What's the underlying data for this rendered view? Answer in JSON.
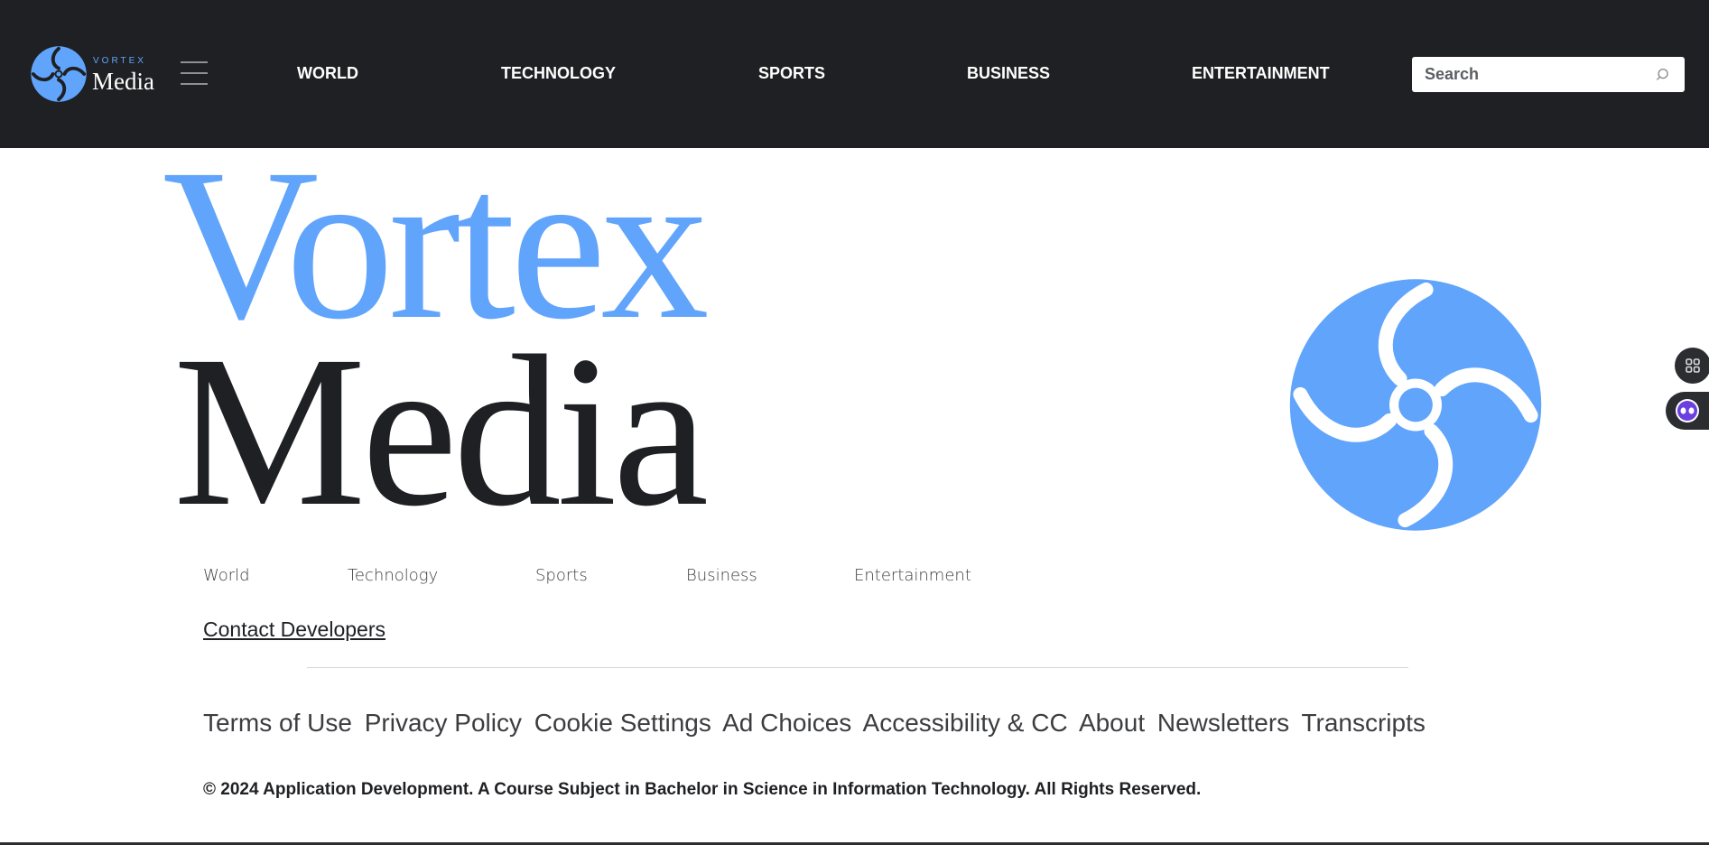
{
  "header": {
    "logo": {
      "top_text": "VORTEX",
      "bottom_text": "Media",
      "icon": "vortex-swirl-logo"
    },
    "menu_icon": "hamburger-menu-icon",
    "nav": [
      {
        "label": "WORLD"
      },
      {
        "label": "TECHNOLOGY"
      },
      {
        "label": "SPORTS"
      },
      {
        "label": "BUSINESS"
      },
      {
        "label": "ENTERTAINMENT"
      }
    ],
    "search": {
      "placeholder": "Search",
      "icon": "search-icon"
    }
  },
  "hero": {
    "title_line1": "Vortex",
    "title_line2": "Media",
    "icon": "vortex-swirl-logo"
  },
  "footer": {
    "sections": [
      {
        "label": "World"
      },
      {
        "label": "Technology"
      },
      {
        "label": "Sports"
      },
      {
        "label": "Business"
      },
      {
        "label": "Entertainment"
      }
    ],
    "contact_link": "Contact Developers",
    "legal_links": [
      {
        "label": "Terms of Use"
      },
      {
        "label": "Privacy Policy"
      },
      {
        "label": "Cookie Settings"
      },
      {
        "label": "Ad Choices"
      },
      {
        "label": "Accessibility & CC"
      },
      {
        "label": "About"
      },
      {
        "label": "Newsletters"
      },
      {
        "label": "Transcripts"
      }
    ],
    "copyright": "© 2024 Application Development. A Course Subject in Bachelor in Science in Information Technology. All Rights Reserved."
  },
  "side_widgets": [
    {
      "icon": "apps-grid-icon"
    },
    {
      "icon": "assistant-bot-icon"
    }
  ],
  "colors": {
    "header_bg": "#1f2023",
    "accent_blue": "#61a4fb",
    "text_dark": "#1f2023",
    "divider": "#d4d5d8"
  }
}
